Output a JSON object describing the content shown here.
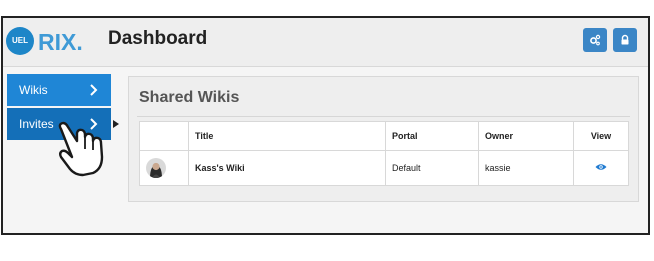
{
  "header": {
    "logo_badge_text": "UEL",
    "logo_wordmark": "RIX.",
    "title": "Dashboard"
  },
  "toolbar": {
    "buttons": [
      {
        "icon": "gears-icon"
      },
      {
        "icon": "lock-icon"
      }
    ]
  },
  "sidebar": {
    "items": [
      {
        "label": "Wikis",
        "icon": "chevron-right-icon"
      },
      {
        "label": "Invites",
        "icon": "chevron-right-icon",
        "active": true
      }
    ]
  },
  "shared_wikis": {
    "title": "Shared Wikis",
    "columns": [
      "",
      "Title",
      "Portal",
      "Owner",
      "View"
    ],
    "rows": [
      {
        "title": "Kass's Wiki",
        "portal": "Default",
        "owner": "kassie",
        "view_icon": "eye-icon"
      }
    ]
  },
  "colors": {
    "accent_blue": "#1f86d6",
    "toolbar_button": "#3b86c6",
    "logo_dot": "#e2533c"
  }
}
